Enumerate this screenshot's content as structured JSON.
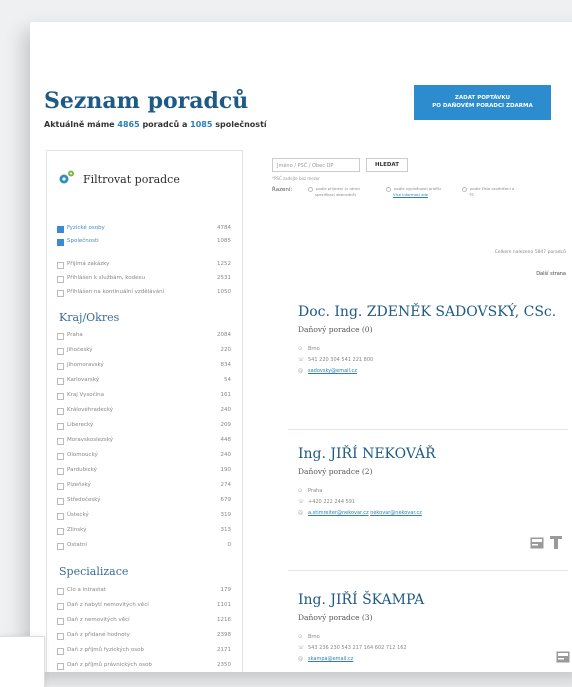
{
  "header": {
    "title": "Seznam poradců",
    "subtitle_prefix": "Aktuálně máme",
    "advisors_count": "4865",
    "advisors_word": "poradců a",
    "companies_count": "1085",
    "companies_word": "společností",
    "cta_label": "ZADAT POPTÁVKU\nPO DAŇOVÉM PORADCI ZDARMA"
  },
  "filter": {
    "title": "Filtrovat poradce",
    "top_items": [
      {
        "label": "Fyzické osoby",
        "count": "4784",
        "checked": true
      },
      {
        "label": "Společnosti",
        "count": "1085",
        "checked": true
      },
      {
        "label": "Přijímá zakázky",
        "count": "1252",
        "checked": false
      },
      {
        "label": "Přihlášen k službám, kodexu",
        "count": "2531",
        "checked": false
      },
      {
        "label": "Přihlášen na kontinuální vzdělávání",
        "count": "1050",
        "checked": false
      }
    ],
    "region_title": "Kraj/Okres",
    "regions": [
      {
        "label": "Praha",
        "count": "2084"
      },
      {
        "label": "Jihočeský",
        "count": "220"
      },
      {
        "label": "Jihomoravský",
        "count": "834"
      },
      {
        "label": "Karlovarský",
        "count": "54"
      },
      {
        "label": "Kraj Vysočina",
        "count": "161"
      },
      {
        "label": "Královéhradecký",
        "count": "240"
      },
      {
        "label": "Liberecký",
        "count": "209"
      },
      {
        "label": "Moravskoslezský",
        "count": "448"
      },
      {
        "label": "Olomoucký",
        "count": "240"
      },
      {
        "label": "Pardubický",
        "count": "190"
      },
      {
        "label": "Plzeňský",
        "count": "274"
      },
      {
        "label": "Středočeský",
        "count": "679"
      },
      {
        "label": "Ústecký",
        "count": "319"
      },
      {
        "label": "Zlínský",
        "count": "313"
      },
      {
        "label": "Ostatní",
        "count": "0"
      }
    ],
    "spec_title": "Specializace",
    "specs": [
      {
        "label": "Clo a intrastat",
        "count": "179"
      },
      {
        "label": "Daň z nabytí nemovitých věcí",
        "count": "1101"
      },
      {
        "label": "Daň z nemovitých věcí",
        "count": "1216"
      },
      {
        "label": "Daň z přidané hodnoty",
        "count": "2398"
      },
      {
        "label": "Daň z příjmů fyzických osob",
        "count": "2171"
      },
      {
        "label": "Daň z příjmů právnických osob",
        "count": "2350"
      }
    ]
  },
  "search": {
    "placeholder": "Jméno / PSČ / Obec DP",
    "button": "HLEDAT",
    "hint": "*PSČ zadejte bez mezer",
    "sort_label": "Řazení:",
    "sort_options": [
      {
        "line1": "podle příjmení (v rámci",
        "line2": "specifikací abecedně)",
        "link": ""
      },
      {
        "line1": "podle vyplněnosti profilu",
        "line2": "",
        "link": "Více informací zde"
      },
      {
        "line1": "podle čísla osvědčení a",
        "line2": "TS",
        "link": ""
      }
    ]
  },
  "results": {
    "count_text": "Celkem nalezeno 5847 poradců",
    "next_label": "Další strana",
    "advisors": [
      {
        "name": "Doc. Ing. ZDENĚK SADOVSKÝ, CSc.",
        "role": "Daňový poradce (0)",
        "city": "Brno",
        "phone": "541 220 304 541 221 800",
        "email": "sadovsky@email.cz",
        "email2": ""
      },
      {
        "name": "Ing. JIŘÍ NEKOVÁŘ",
        "role": "Daňový poradce (2)",
        "city": "Praha",
        "phone": "+420 222 244 591",
        "email": "a.stimreiter@nekovar.cz",
        "email2": "nekovar@nekovar.cz"
      },
      {
        "name": "Ing. JIŘÍ ŠKAMPA",
        "role": "Daňový poradce (3)",
        "city": "Brno",
        "phone": "543 236 230 543 217 164 602 712 162",
        "email": "skampa@email.cz",
        "email2": ""
      }
    ]
  },
  "icons": {
    "filter": "gear-icon",
    "location": "pin-icon",
    "phone": "phone-icon",
    "email": "email-icon",
    "card": "card-icon",
    "badge": "badge-icon"
  },
  "colors": {
    "brand": "#1e5a86",
    "accent": "#2d8ccd",
    "link": "#2c7fb8"
  }
}
